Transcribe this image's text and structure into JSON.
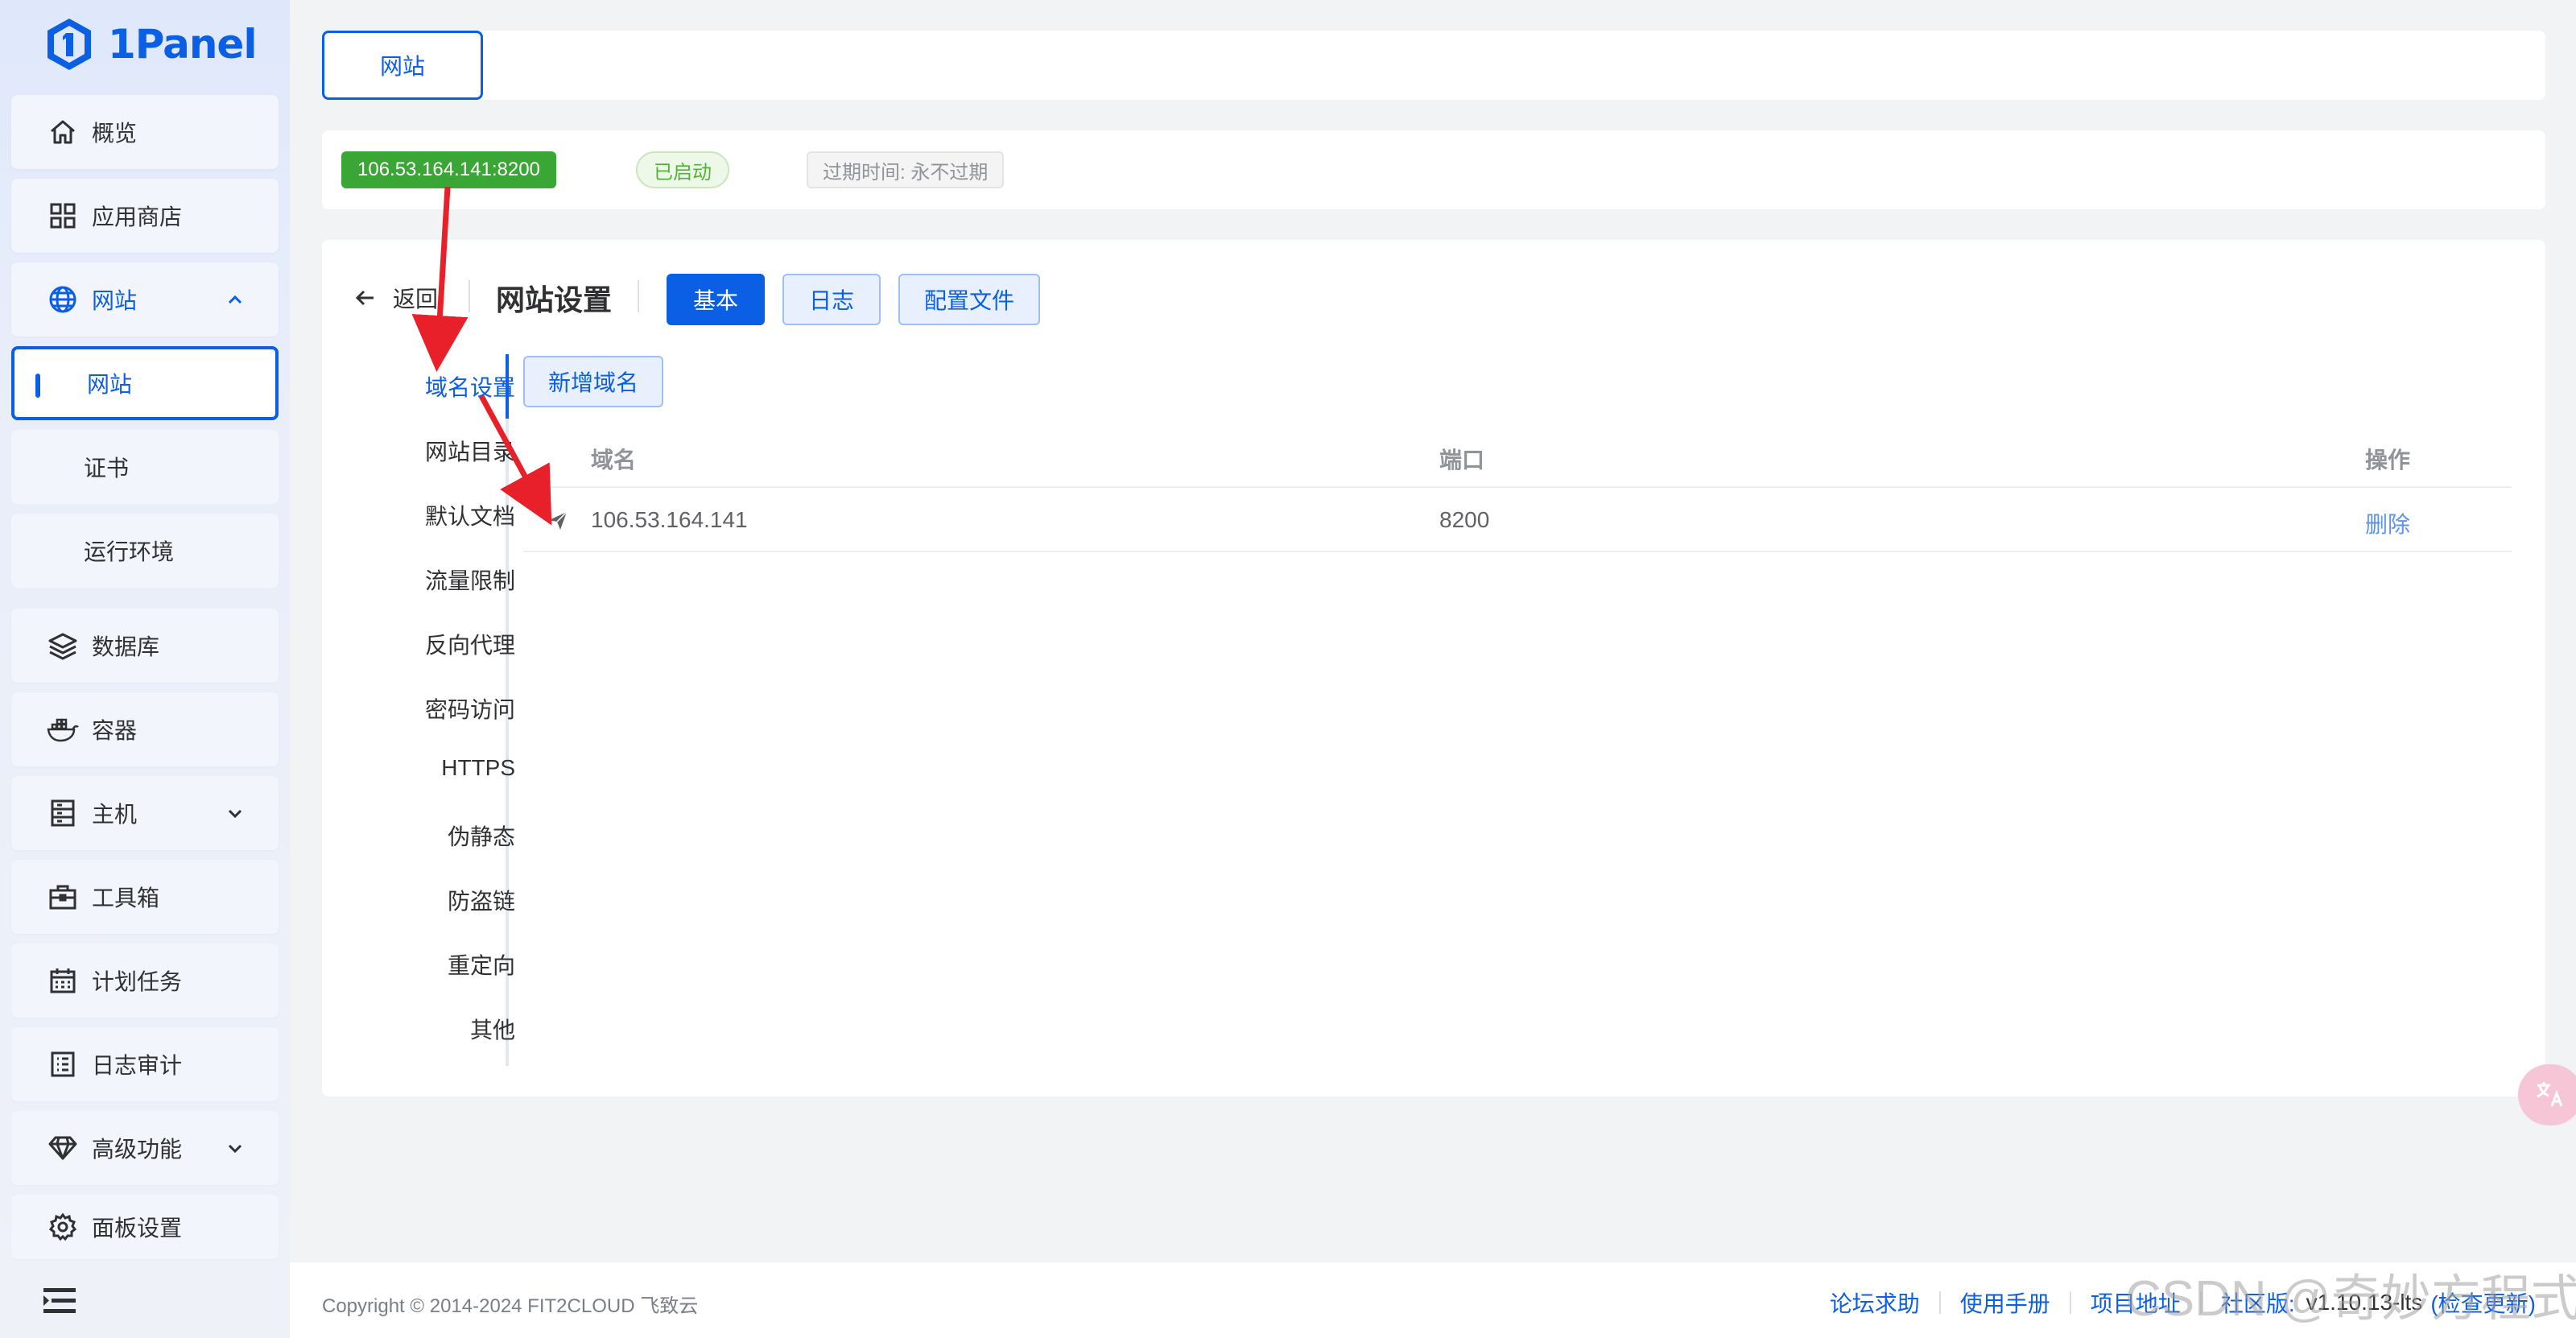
{
  "app": {
    "logo_text": "1Panel"
  },
  "sidebar": {
    "items": [
      {
        "label": "概览",
        "icon": "home-icon"
      },
      {
        "label": "应用商店",
        "icon": "apps-grid-icon"
      },
      {
        "label": "网站",
        "icon": "globe-icon",
        "expanded": true
      },
      {
        "label": "网站",
        "sub": true,
        "selected": true
      },
      {
        "label": "证书",
        "sub": true
      },
      {
        "label": "运行环境",
        "sub": true
      },
      {
        "label": "数据库",
        "icon": "database-layers-icon"
      },
      {
        "label": "容器",
        "icon": "docker-icon"
      },
      {
        "label": "主机",
        "icon": "server-icon",
        "has_children": true
      },
      {
        "label": "工具箱",
        "icon": "toolbox-icon"
      },
      {
        "label": "计划任务",
        "icon": "calendar-icon"
      },
      {
        "label": "日志审计",
        "icon": "log-list-icon"
      },
      {
        "label": "高级功能",
        "icon": "diamond-icon",
        "has_children": true
      },
      {
        "label": "面板设置",
        "icon": "gear-icon"
      }
    ]
  },
  "tabs": {
    "active_label": "网站"
  },
  "status": {
    "address": "106.53.164.141:8200",
    "running": "已启动",
    "expire": "过期时间: 永不过期"
  },
  "panel": {
    "back_label": "返回",
    "title": "网站设置",
    "segments": [
      "基本",
      "日志",
      "配置文件"
    ],
    "active_segment": "基本",
    "submenu": [
      "域名设置",
      "网站目录",
      "默认文档",
      "流量限制",
      "反向代理",
      "密码访问",
      "HTTPS",
      "伪静态",
      "防盗链",
      "重定向",
      "其他"
    ],
    "active_submenu": "域名设置",
    "add_button": "新增域名",
    "table": {
      "columns": [
        "域名",
        "端口",
        "操作"
      ],
      "rows": [
        {
          "domain": "106.53.164.141",
          "port": "8200",
          "action": "删除"
        }
      ]
    }
  },
  "footer": {
    "copyright": "Copyright © 2014-2024 FIT2CLOUD 飞致云",
    "links": [
      "论坛求助",
      "使用手册",
      "项目地址",
      "社区版:"
    ],
    "version": "v1.10.13-lts",
    "check_update": "(检查更新)",
    "watermark": "CSDN @奇妙方程式"
  },
  "colors": {
    "primary": "#0b5fe4",
    "success_tag": "#3aa635",
    "annotation_arrow": "#e8202a"
  }
}
